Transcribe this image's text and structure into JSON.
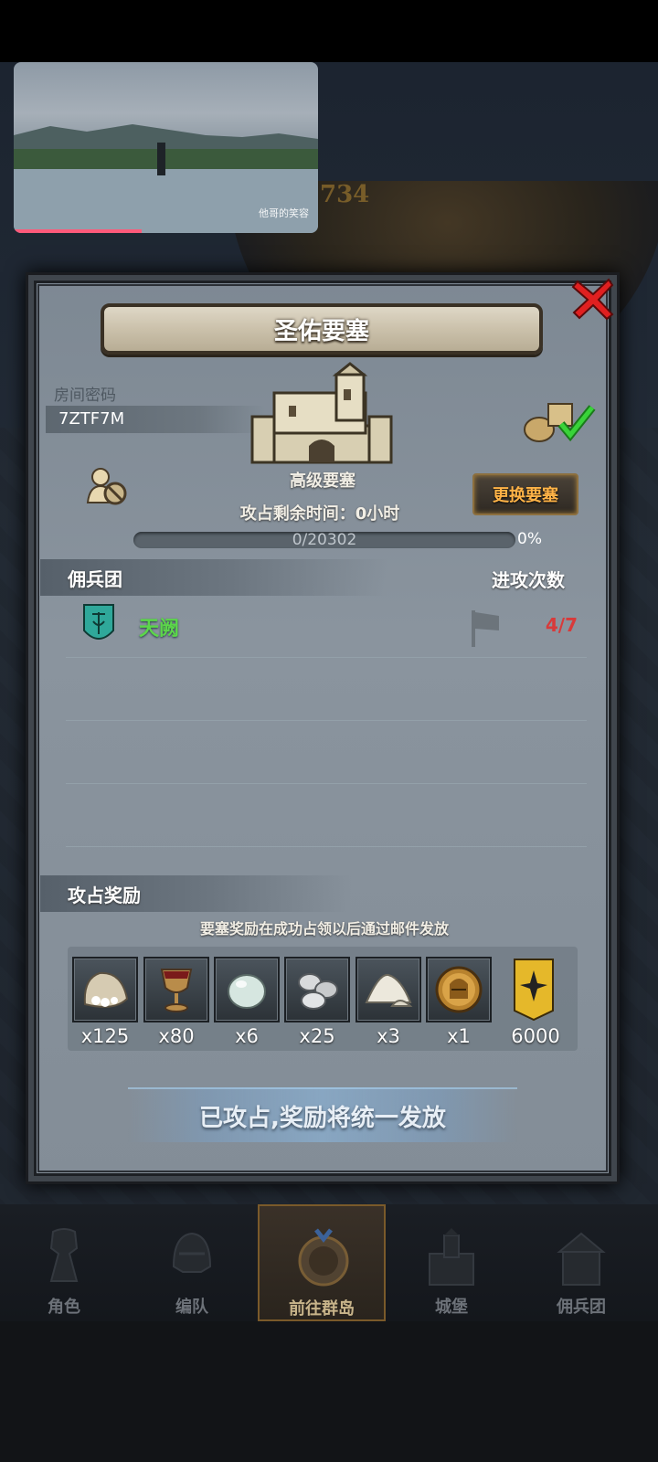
{
  "video": {
    "logo_text": "他哥的笑容"
  },
  "dialog": {
    "title": "圣佑要塞",
    "room_label": "房间密码",
    "room_code": "7ZTF7M",
    "fortress_type": "高级要塞",
    "change_button": "更换要塞",
    "time_left": "攻占剩余时间：0小时",
    "progress_text": "0/20302",
    "progress_value": 0,
    "progress_pct": "0%",
    "guild_section": "佣兵团",
    "attack_count_label": "进攻次数",
    "guilds": [
      {
        "name": "天阙",
        "count": "4/7"
      }
    ],
    "reward_section": "攻占奖励",
    "reward_note": "要塞奖励在成功占领以后通过邮件发放",
    "rewards": [
      {
        "icon": "flour-sack-icon",
        "qty": "x125"
      },
      {
        "icon": "goblet-icon",
        "qty": "x80"
      },
      {
        "icon": "egg-stone-icon",
        "qty": "x6"
      },
      {
        "icon": "silver-ore-icon",
        "qty": "x25"
      },
      {
        "icon": "salt-pile-icon",
        "qty": "x3"
      },
      {
        "icon": "helmet-medal-icon",
        "qty": "x1"
      },
      {
        "icon": "guild-banner-icon",
        "qty": "6000"
      }
    ],
    "status_banner": "已攻占,奖励将统一发放"
  },
  "bottom_nav": {
    "items": [
      {
        "label": "角色",
        "icon": "knight-icon"
      },
      {
        "label": "编队",
        "icon": "helmet-icon"
      },
      {
        "label": "前往群岛",
        "icon": "compass-icon",
        "active": true
      },
      {
        "label": "城堡",
        "icon": "castle-icon"
      },
      {
        "label": "佣兵团",
        "icon": "guild-hall-icon"
      }
    ]
  },
  "colors": {
    "guild_name": "#5cd64a",
    "attack_count": "#d83a3a",
    "change_button_text": "#ffb347",
    "video_progress": "#ff5a7a"
  }
}
